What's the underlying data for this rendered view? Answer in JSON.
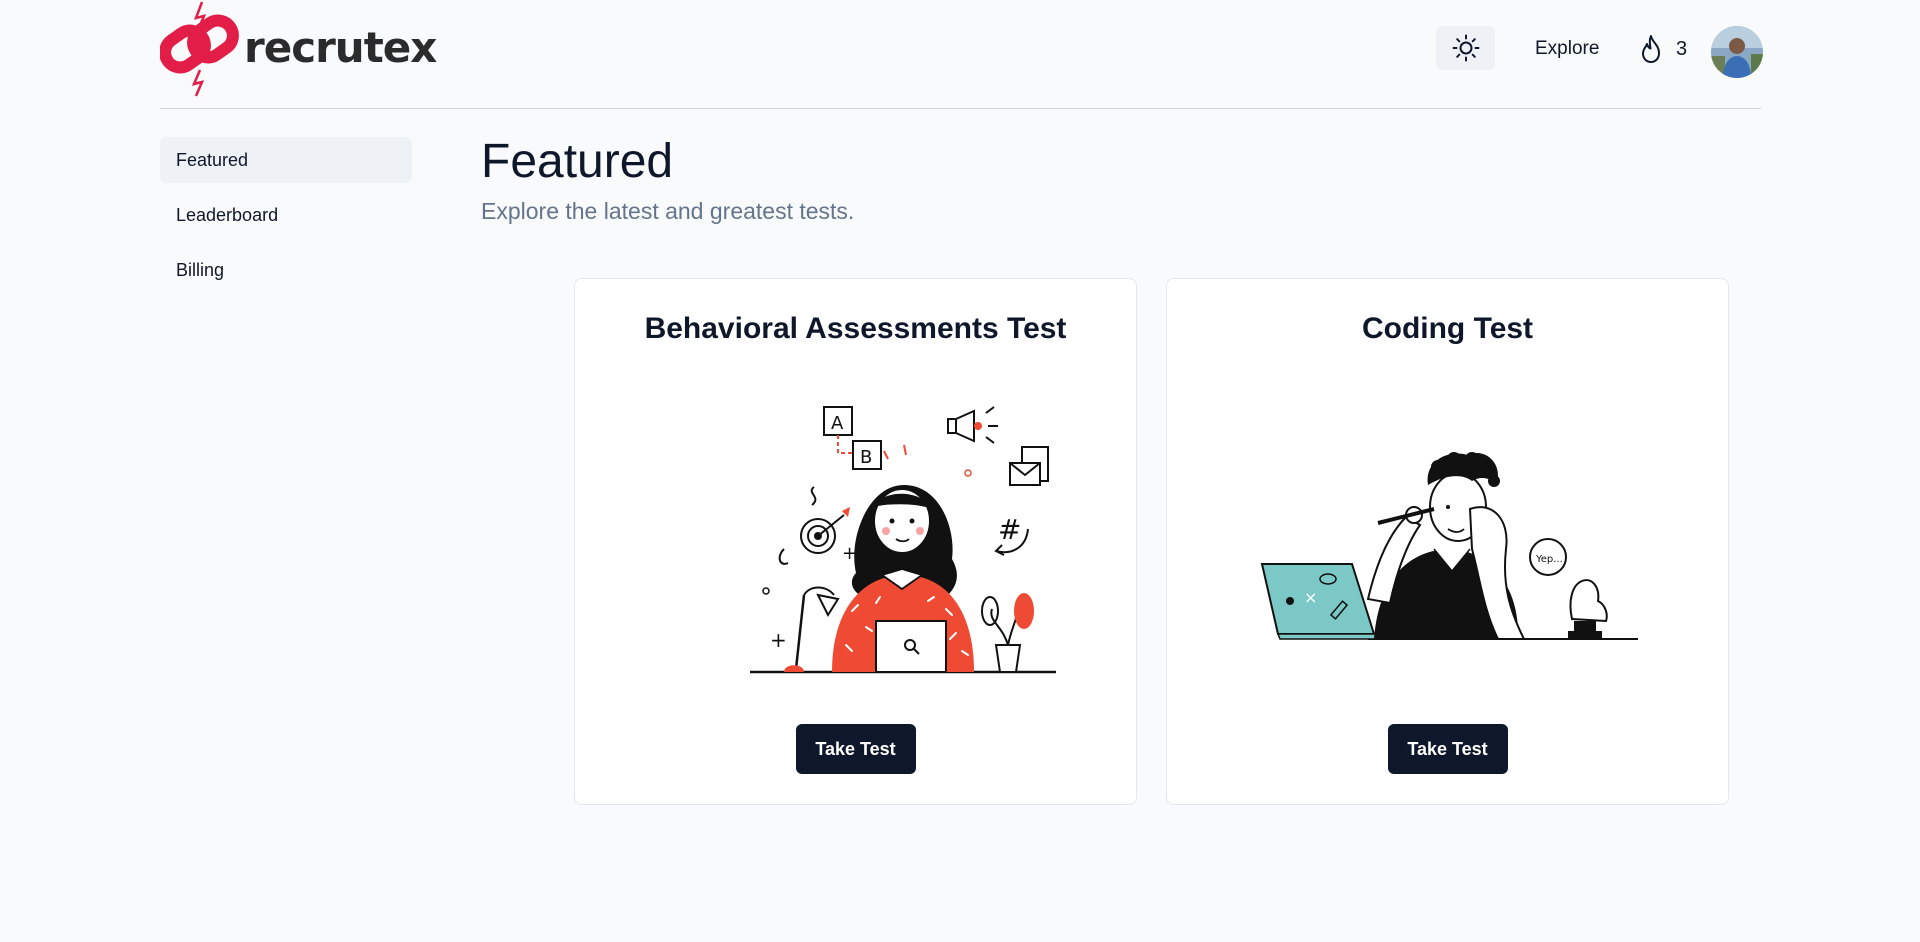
{
  "brand": {
    "name": "recrutex",
    "icon": "chain-link-logo",
    "accent": "#e11d48"
  },
  "header": {
    "theme_toggle_icon": "sun-icon",
    "explore_label": "Explore",
    "streak_icon": "flame-icon",
    "streak_count": "3",
    "avatar_icon": "user-avatar"
  },
  "sidebar": {
    "items": [
      {
        "label": "Featured",
        "active": true
      },
      {
        "label": "Leaderboard",
        "active": false
      },
      {
        "label": "Billing",
        "active": false
      }
    ]
  },
  "main": {
    "title": "Featured",
    "subtitle": "Explore the latest and greatest tests."
  },
  "cards": [
    {
      "title": "Behavioral Assessments Test",
      "illustration": "woman-at-laptop-illustration",
      "button_label": "Take Test"
    },
    {
      "title": "Coding Test",
      "illustration": "man-thinking-at-laptop-illustration",
      "button_label": "Take Test"
    }
  ],
  "colors": {
    "primary_button": "#0f172a",
    "subtitle": "#64748b",
    "illustration_red": "#ef4a33",
    "illustration_teal": "#7cc8c6"
  }
}
